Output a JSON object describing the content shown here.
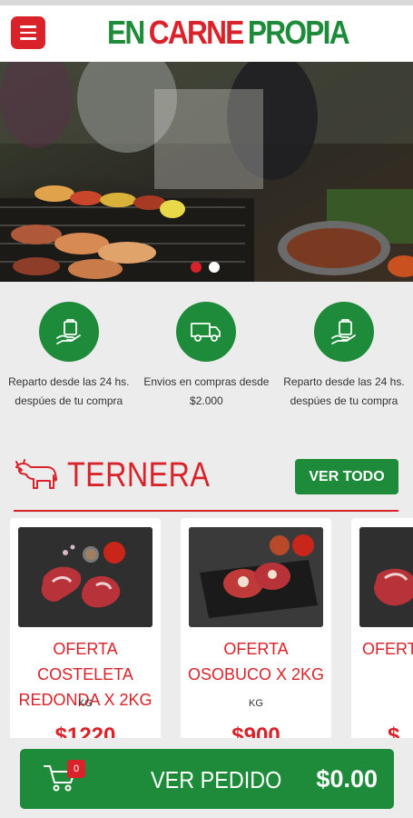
{
  "app": {
    "logo_part1": "EN",
    "logo_part2": "CARNE",
    "logo_part3": "PROPIA"
  },
  "colors": {
    "brand_green": "#1e8b3a",
    "brand_red": "#d9222a",
    "background": "#ececec"
  },
  "hero": {
    "slide_count": 2,
    "active_slide": 1
  },
  "features": [
    {
      "icon": "hand-bag-icon",
      "text": "Reparto desde las 24 hs. despúes de tu compra"
    },
    {
      "icon": "truck-icon",
      "text": "Envios en compras desde $2.000"
    },
    {
      "icon": "hand-bag-icon",
      "text": "Reparto desde las 24 hs. despúes de tu compra"
    }
  ],
  "section": {
    "title": "TERNERA",
    "icon": "cow-icon",
    "see_all_label": "VER TODO"
  },
  "products": [
    {
      "name": "OFERTA COSTELETA REDONDA X 2KG",
      "unit": "KG",
      "price": "$1220"
    },
    {
      "name": "OFERTA OSOBUCO X 2KG",
      "unit": "KG",
      "price": "$900"
    },
    {
      "name": "OFERTA ANCH",
      "unit": "",
      "price": "$"
    }
  ],
  "cart": {
    "count": "0",
    "label": "VER PEDIDO",
    "total": "$0.00"
  }
}
